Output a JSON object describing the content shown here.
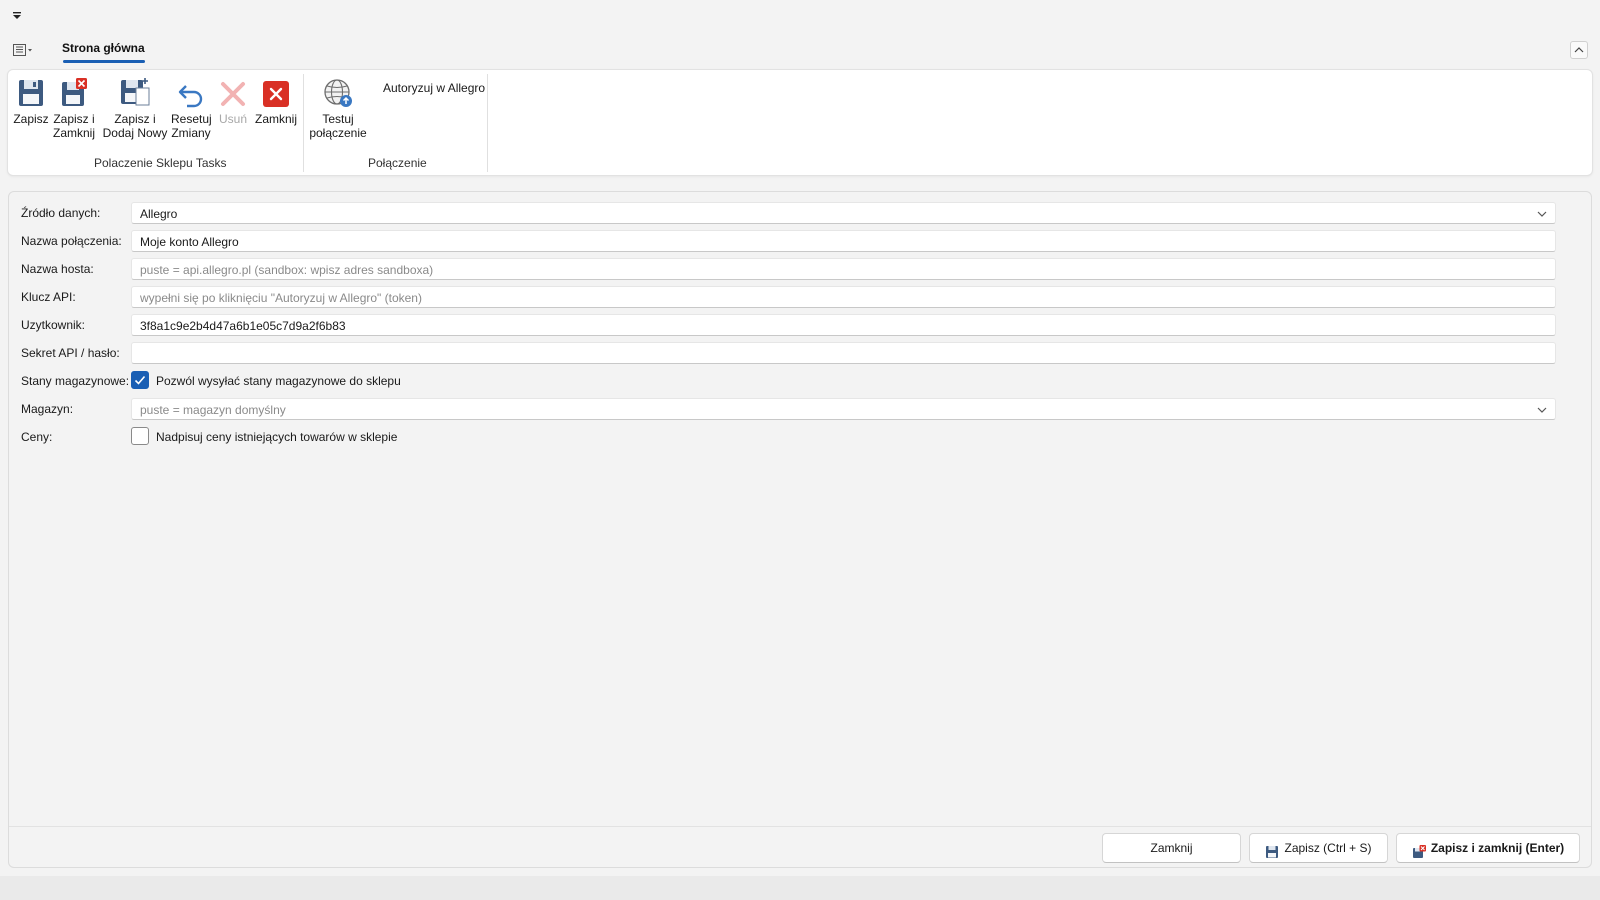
{
  "ribbon": {
    "tab_label": "Strona główna",
    "buttons": {
      "save": "Zapisz",
      "save_close_1": "Zapisz i",
      "save_close_2": "Zamknij",
      "save_new_1": "Zapisz i",
      "save_new_2": "Dodaj Nowy",
      "reset_1": "Resetuj",
      "reset_2": "Zmiany",
      "delete": "Usuń",
      "close": "Zamknij",
      "test_1": "Testuj",
      "test_2": "połączenie",
      "authorize": "Autoryzuj w Allegro"
    },
    "groups": {
      "main": "Polaczenie Sklepu Tasks",
      "connection": "Połączenie"
    }
  },
  "form": {
    "source": {
      "label": "Źródło danych:",
      "value": "Allegro"
    },
    "conn_name": {
      "label": "Nazwa połączenia:",
      "value": "Moje konto Allegro"
    },
    "host": {
      "label": "Nazwa hosta:",
      "placeholder": "puste = api.allegro.pl (sandbox: wpisz adres sandboxa)"
    },
    "api_key": {
      "label": "Klucz API:",
      "placeholder": "wypełni się po kliknięciu \"Autoryzuj w Allegro\" (token)"
    },
    "user": {
      "label": "Uzytkownik:",
      "value": "3f8a1c9e2b4d47a6b1e05c7d9a2f6b83"
    },
    "secret": {
      "label": "Sekret API / hasło:",
      "value": ""
    },
    "stock": {
      "label": "Stany magazynowe:",
      "checkbox_label": "Pozwól wysyłać stany magazynowe do sklepu",
      "checked": true
    },
    "warehouse": {
      "label": "Magazyn:",
      "placeholder": "puste = magazyn domyślny"
    },
    "prices": {
      "label": "Ceny:",
      "checkbox_label": "Nadpisuj ceny istniejących towarów w sklepie",
      "checked": false
    }
  },
  "footer": {
    "close": "Zamknij",
    "save": "Zapisz (Ctrl + S)",
    "save_close": "Zapisz i zamknij (Enter)"
  },
  "colors": {
    "accent": "#1a5fb4",
    "close_red": "#d93025"
  }
}
